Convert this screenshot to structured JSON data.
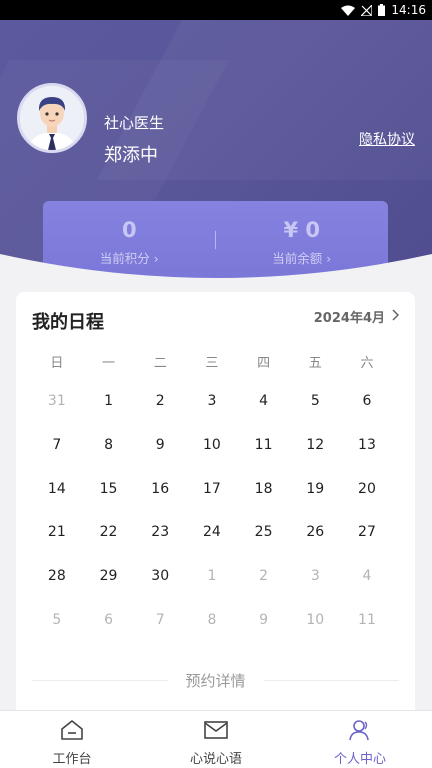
{
  "status_bar": {
    "time": "14:16"
  },
  "profile": {
    "role": "社心医生",
    "name": "郑添中",
    "privacy_link": "隐私协议"
  },
  "balance": {
    "points_value": "0",
    "points_label": "当前积分 ›",
    "amount_value": "¥ 0",
    "amount_label": "当前余额 ›"
  },
  "schedule": {
    "title": "我的日程",
    "month": "2024年4月",
    "weekdays": [
      "日",
      "一",
      "二",
      "三",
      "四",
      "五",
      "六"
    ],
    "weeks": [
      [
        "31",
        "1",
        "2",
        "3",
        "4",
        "5",
        "6"
      ],
      [
        "7",
        "8",
        "9",
        "10",
        "11",
        "12",
        "13"
      ],
      [
        "14",
        "15",
        "16",
        "17",
        "18",
        "19",
        "20"
      ],
      [
        "21",
        "22",
        "23",
        "24",
        "25",
        "26",
        "27"
      ],
      [
        "28",
        "29",
        "30",
        "1",
        "2",
        "3",
        "4"
      ],
      [
        "5",
        "6",
        "7",
        "8",
        "9",
        "10",
        "11"
      ]
    ],
    "appointment_heading": "预约详情"
  },
  "tabs": [
    {
      "label": "工作台",
      "icon": "home-icon",
      "active": false
    },
    {
      "label": "心说心语",
      "icon": "mail-icon",
      "active": false
    },
    {
      "label": "个人中心",
      "icon": "user-icon",
      "active": true
    }
  ],
  "colors": {
    "header": "#5a569a",
    "accent": "#6a63c9",
    "card": "#7b77d8"
  }
}
